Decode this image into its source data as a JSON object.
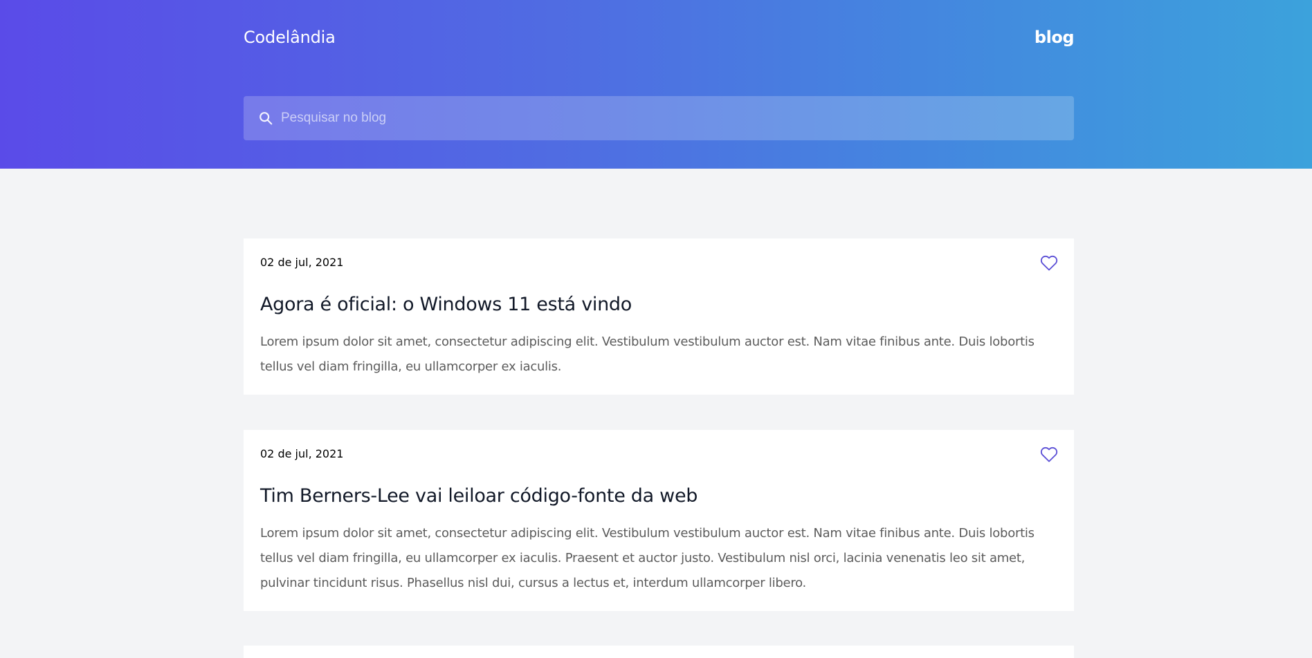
{
  "header": {
    "brand": "Codelândia",
    "nav_blog": "blog",
    "search": {
      "placeholder": "Pesquisar no blog",
      "icon": "search-icon"
    }
  },
  "posts": [
    {
      "date": "02 de jul, 2021",
      "title": "Agora é oficial: o Windows 11 está vindo",
      "excerpt": "Lorem ipsum dolor sit amet, consectetur adipiscing elit. Vestibulum vestibulum auctor est. Nam vitae finibus ante. Duis lobortis tellus vel diam fringilla, eu ullamcorper ex iaculis.",
      "like_icon": "heart-outline-icon"
    },
    {
      "date": "02 de jul, 2021",
      "title": "Tim Berners-Lee vai leiloar código-fonte da web",
      "excerpt": "Lorem ipsum dolor sit amet, consectetur adipiscing elit. Vestibulum vestibulum auctor est. Nam vitae finibus ante. Duis lobortis tellus vel diam fringilla, eu ullamcorper ex iaculis. Praesent et auctor justo. Vestibulum nisl orci, lacinia venenatis leo sit amet, pulvinar tincidunt risus. Phasellus nisl dui, cursus a lectus et, interdum ullamcorper libero.",
      "like_icon": "heart-outline-icon"
    }
  ],
  "colors": {
    "accent": "#5a4be8",
    "heart": "#5b4fd6",
    "page_background": "#f3f4f6"
  }
}
